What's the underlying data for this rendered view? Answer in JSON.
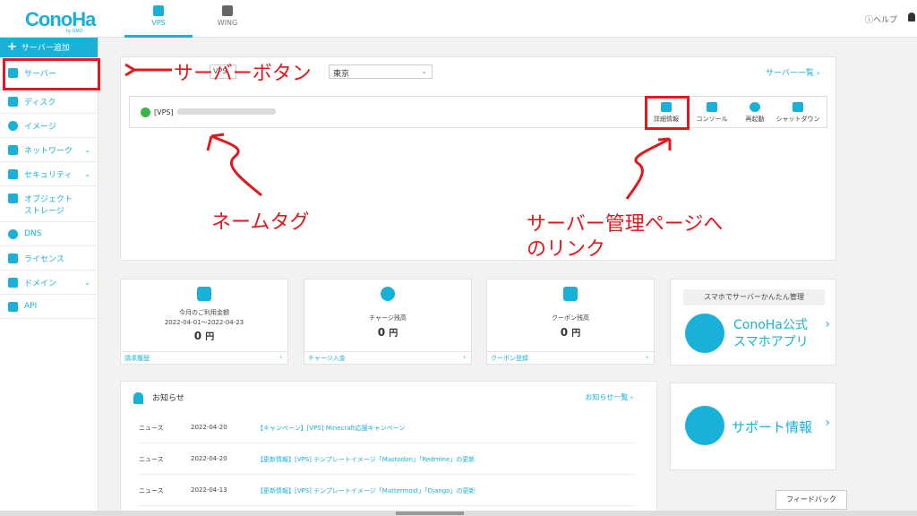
{
  "header": {
    "logo": "ConoHa",
    "logo_sub": "by GMO",
    "tabs": [
      {
        "label": "VPS"
      },
      {
        "label": "WING"
      }
    ],
    "help": "ヘルプ"
  },
  "sidebar": {
    "add_button": "サーバー追加",
    "items": [
      {
        "label": "サーバー"
      },
      {
        "label": "ディスク"
      },
      {
        "label": "イメージ"
      },
      {
        "label": "ネットワーク"
      },
      {
        "label": "セキュリティ"
      },
      {
        "label": "オブジェクト"
      },
      {
        "label": "ストレージ"
      },
      {
        "label": "DNS"
      },
      {
        "label": "ライセンス"
      },
      {
        "label": "ドメイン"
      },
      {
        "label": "API"
      }
    ]
  },
  "server_panel": {
    "region_label": "VPS",
    "region_value": "東京",
    "server_list_link": "サーバー一覧",
    "server_name": "[VPS]",
    "actions": [
      {
        "label": "詳細情報",
        "icon": "gear-icon"
      },
      {
        "label": "コンソール",
        "icon": "console-icon"
      },
      {
        "label": "再起動",
        "icon": "restart-icon"
      },
      {
        "label": "シャットダウン",
        "icon": "shutdown-icon"
      }
    ]
  },
  "annotations": {
    "server_button": "サーバーボタン",
    "name_tag": "ネームタグ",
    "manage_link_1": "サーバー管理ページへ",
    "manage_link_2": "のリンク"
  },
  "cards": [
    {
      "title": "今月のご利用金額",
      "subtitle": "2022-04-01〜2022-04-23",
      "value": "0",
      "unit": "円",
      "link": "請求履歴"
    },
    {
      "title": "チャージ残高",
      "subtitle": "",
      "value": "0",
      "unit": "円",
      "link": "チャージ入金"
    },
    {
      "title": "クーポン残高",
      "subtitle": "",
      "value": "0",
      "unit": "円",
      "link": "クーポン登録"
    }
  ],
  "promo": {
    "header": "スマホでサーバーかんたん管理",
    "app_line1": "ConoHa公式",
    "app_line2": "スマホアプリ",
    "support": "サポート情報"
  },
  "news": {
    "title": "お知らせ",
    "all_link": "お知らせ一覧",
    "rows": [
      {
        "cat": "ニュース",
        "date": "2022-04-20",
        "text": "【キャンペーン】[VPS] Minecraft応援キャンペーン"
      },
      {
        "cat": "ニュース",
        "date": "2022-04-20",
        "text": "【更新情報】[VPS] テンプレートイメージ「Mastodon」「Redmine」の更新"
      },
      {
        "cat": "ニュース",
        "date": "2022-04-13",
        "text": "【更新情報】[VPS] テンプレートイメージ「Mattermost」「Django」の更新"
      }
    ]
  },
  "feedback": "フィードバック",
  "colors": {
    "accent": "#19b1d8",
    "annotation": "#e0191e",
    "power": "#3ab54a"
  }
}
